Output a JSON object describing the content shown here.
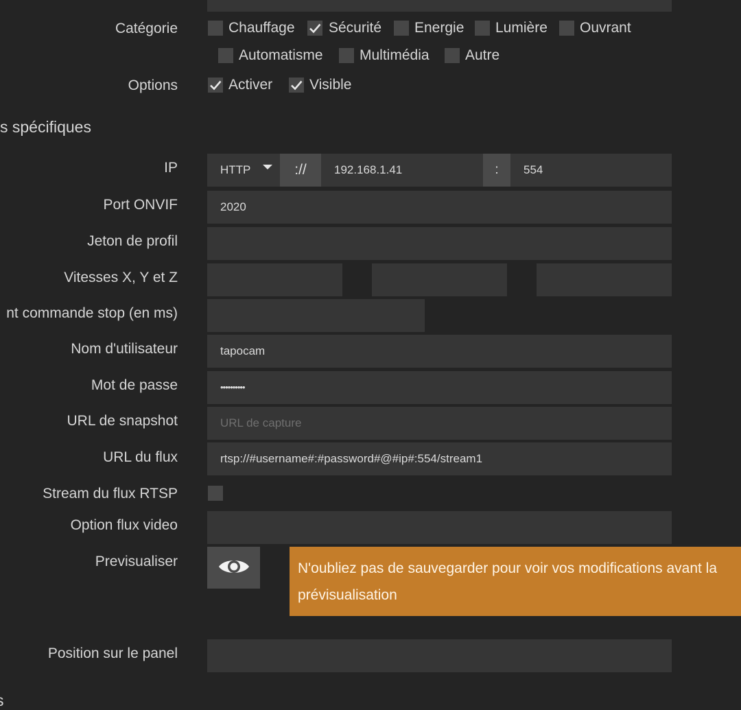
{
  "form": {
    "category": {
      "label": "Catégorie",
      "options": [
        {
          "label": "Chauffage",
          "checked": false
        },
        {
          "label": "Sécurité",
          "checked": true
        },
        {
          "label": "Energie",
          "checked": false
        },
        {
          "label": "Lumière",
          "checked": false
        },
        {
          "label": "Ouvrant",
          "checked": false
        },
        {
          "label": "Automatisme",
          "checked": false
        },
        {
          "label": "Multimédia",
          "checked": false
        },
        {
          "label": "Autre",
          "checked": false
        }
      ]
    },
    "options": {
      "label": "Options",
      "items": [
        {
          "label": "Activer",
          "checked": true
        },
        {
          "label": "Visible",
          "checked": true
        }
      ]
    },
    "section_title": "s spécifiques",
    "ip": {
      "label": "IP",
      "protocol": "HTTP",
      "separator": "://",
      "address": "192.168.1.41",
      "port_separator": ":",
      "port": "554"
    },
    "onvif_port": {
      "label": "Port ONVIF",
      "value": "2020"
    },
    "profile_token": {
      "label": "Jeton de profil",
      "value": ""
    },
    "speeds": {
      "label": "Vitesses X, Y et Z",
      "x": "",
      "y": "",
      "z": ""
    },
    "stop_command": {
      "label": "nt commande stop (en ms)",
      "value": ""
    },
    "username": {
      "label": "Nom d'utilisateur",
      "value": "tapocam"
    },
    "password": {
      "label": "Mot de passe",
      "value": "••••••••••"
    },
    "snapshot_url": {
      "label": "URL de snapshot",
      "placeholder": "URL de capture",
      "value": ""
    },
    "stream_url": {
      "label": "URL du flux",
      "value": "rtsp://#username#:#password#@#ip#:554/stream1"
    },
    "rtsp_stream": {
      "label": "Stream du flux RTSP",
      "checked": false
    },
    "video_option": {
      "label": "Option flux video",
      "value": ""
    },
    "preview": {
      "label": "Previsualiser",
      "icon": "eye-icon"
    },
    "alert": {
      "text": "N'oubliez pas de sauvegarder pour voir vos modifications avant la prévisualisation"
    },
    "panel_position": {
      "label": "Position sur le panel",
      "value": ""
    },
    "bottom_fragment": "s"
  },
  "colors": {
    "background": "#242424",
    "field": "#363636",
    "checkbox": "#474747",
    "alert": "#c47d2a"
  }
}
